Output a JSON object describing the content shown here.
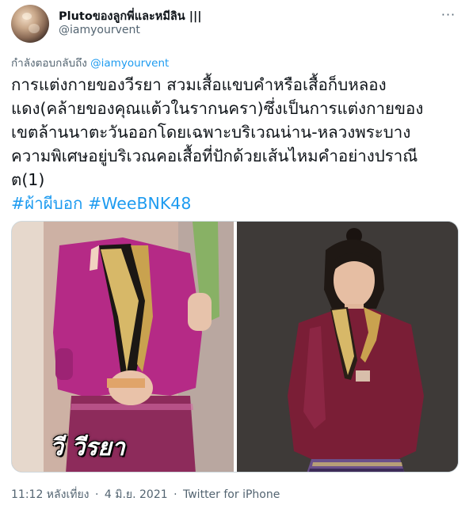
{
  "user": {
    "display_name": "Plutoของลูกพี่และหมีลิน |||",
    "handle": "@iamyourvent"
  },
  "menu": {
    "more_icon": "more-horizontal-icon",
    "more_glyph": "···"
  },
  "reply_context": {
    "prefix": "กำลังตอบกลับถึง",
    "mention": "@iamyourvent"
  },
  "tweet": {
    "lines": [
      "การแต่งกายของวีรยา สวมเสื้อแขบคำหรือเสื้อก็บหลอง",
      "แดง(คล้ายของคุณแต้วในรากนครา)ซึ่งเป็นการแต่งกายของ",
      "เขตล้านนาตะวันออกโดยเฉพาะบริเวณน่าน-หลวงพระบาง",
      "ความพิเศษอยู่บริเวณคอเสื้อที่ปักด้วยเส้นไหมคำอย่างปราณี",
      "ต(1)"
    ],
    "hashtag_1": "#ผ้าผีบอก",
    "hashtag_2": "#WeeBNK48"
  },
  "media": {
    "left_caption": "วี วีรยา"
  },
  "footer": {
    "time": "11:12 หลังเที่ยง",
    "separator": "·",
    "date": "4 มิ.ย. 2021",
    "source": "Twitter for iPhone"
  },
  "colors": {
    "link": "#1d9bf0",
    "secondary_text": "#536471",
    "primary_text": "#0f1419",
    "border": "#cfd9de"
  }
}
